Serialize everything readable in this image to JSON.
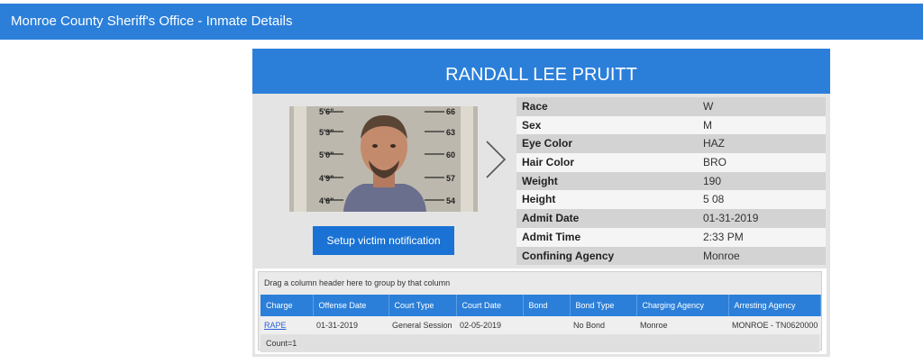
{
  "header": {
    "title": "Monroe County Sheriff's Office - Inmate Details"
  },
  "inmate": {
    "name": "RANDALL LEE PRUITT"
  },
  "photo": {
    "height_marks": [
      "5'6\"",
      "5'3\"",
      "5'0\"",
      "4'9\"",
      "4'6\""
    ],
    "right_marks": [
      "66",
      "63",
      "60",
      "57",
      "54"
    ]
  },
  "actions": {
    "notify_label": "Setup victim notification"
  },
  "details": [
    {
      "label": "Race",
      "value": "W"
    },
    {
      "label": "Sex",
      "value": "M"
    },
    {
      "label": "Eye Color",
      "value": "HAZ"
    },
    {
      "label": "Hair Color",
      "value": "BRO"
    },
    {
      "label": "Weight",
      "value": "190"
    },
    {
      "label": "Height",
      "value": "5 08"
    },
    {
      "label": "Admit Date",
      "value": "01-31-2019"
    },
    {
      "label": "Admit Time",
      "value": "2:33 PM"
    },
    {
      "label": "Confining Agency",
      "value": "Monroe"
    }
  ],
  "grid": {
    "group_hint": "Drag a column header here to group by that column",
    "columns": [
      "Charge",
      "Offense Date",
      "Court Type",
      "Court Date",
      "Bond",
      "Bond Type",
      "Charging Agency",
      "Arresting Agency"
    ],
    "rows": [
      [
        "RAPE",
        "01-31-2019",
        "General Session",
        "02-05-2019",
        "",
        "No Bond",
        "Monroe",
        "MONROE - TN0620000"
      ]
    ],
    "count_text": "Count=1"
  }
}
